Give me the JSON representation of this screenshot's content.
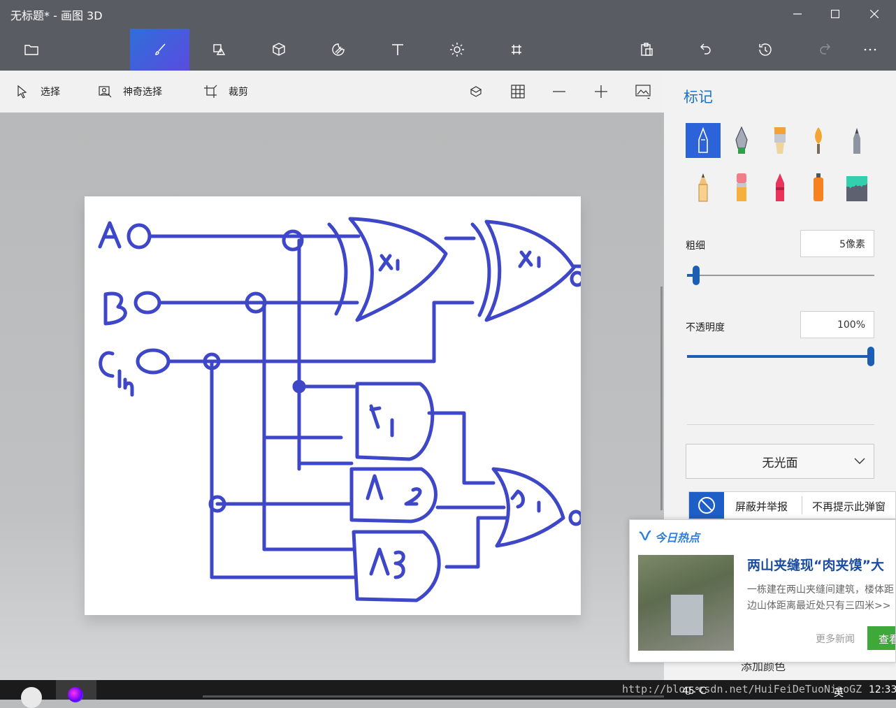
{
  "window": {
    "title": "无标题* - 画图 3D"
  },
  "toolbar": {
    "tabs": [
      {
        "name": "menu",
        "icon": "folder-icon"
      },
      {
        "name": "art-tools",
        "icon": "brush-icon",
        "active": true
      },
      {
        "name": "2d-shapes",
        "icon": "shapes-icon"
      },
      {
        "name": "3d-shapes",
        "icon": "cube-icon"
      },
      {
        "name": "stickers",
        "icon": "sticker-icon"
      },
      {
        "name": "text",
        "icon": "text-icon"
      },
      {
        "name": "effects",
        "icon": "sun-icon"
      },
      {
        "name": "canvas",
        "icon": "canvas-icon"
      }
    ],
    "right_icons": [
      "paste-icon",
      "undo-icon",
      "history-icon",
      "redo-icon",
      "more-icon"
    ],
    "accent": "#4a5fe0"
  },
  "subbar": {
    "select": "选择",
    "magic_select": "神奇选择",
    "crop": "裁剪"
  },
  "panel": {
    "title": "标记",
    "thickness_label": "粗细",
    "thickness_value": "5像素",
    "thickness_level": 0.05,
    "opacity_label": "不透明度",
    "opacity_value": "100%",
    "opacity_level": 1.0,
    "finish": "无光面",
    "add_color": "添加颜色",
    "brushes": [
      "marker",
      "calligraphy-pen",
      "oil-brush",
      "watercolor",
      "pixel-pen",
      "pencil",
      "eraser",
      "crayon",
      "spray-can",
      "fill"
    ]
  },
  "drawing": {
    "inputs": [
      "AO",
      "BO",
      "Cin"
    ],
    "gates": [
      "X1",
      "X1",
      "A1",
      "A2",
      "A3",
      "O1"
    ],
    "ink_color": "#3f47c9"
  },
  "popup": {
    "block_report": "屏蔽并举报",
    "no_more": "不再提示此弹窗",
    "header": "今日热点",
    "headline": "两山夹缝现“肉夹馍”大",
    "body_line1": "一栋建在两山夹缝间建筑，楼体距",
    "body_line2": "边山体距离最近处只有三四米>>",
    "more_news": "更多新闻",
    "view": "查看"
  },
  "taskbar": {
    "temperature": "45°C",
    "clock": "12:33",
    "ime": "英",
    "watermark": "http://blog.csdn.net/HuiFeiDeTuoNiaoGZ"
  }
}
